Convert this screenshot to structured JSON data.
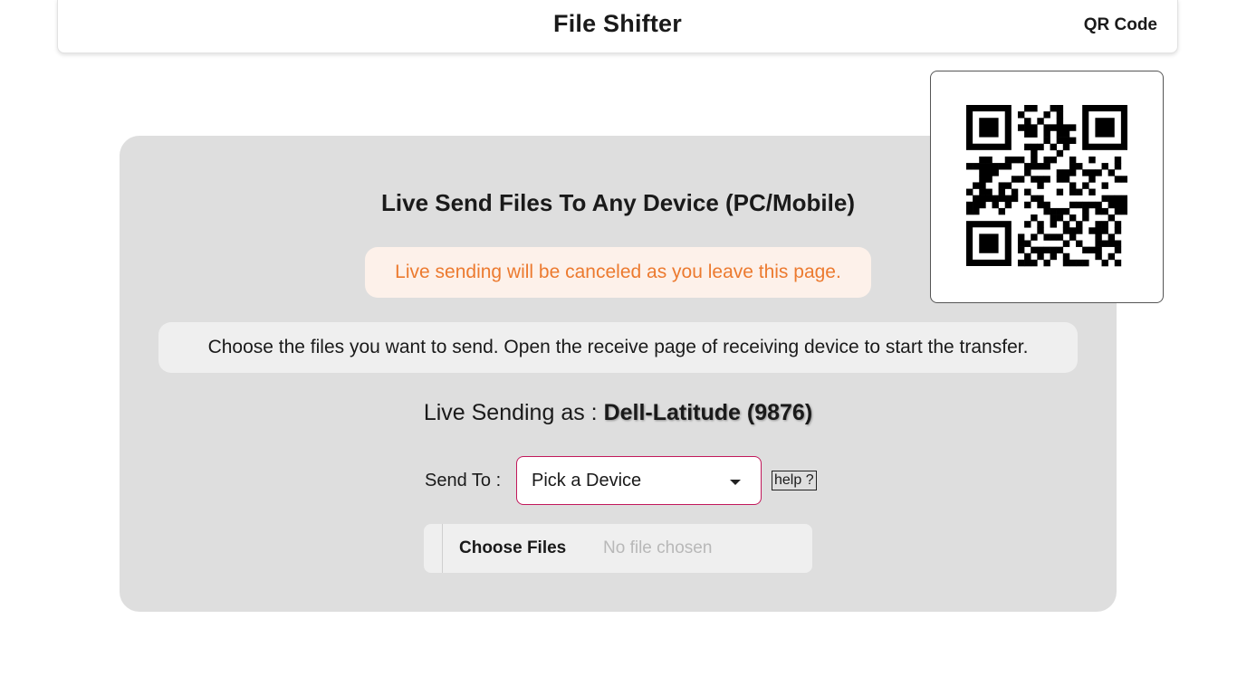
{
  "header": {
    "title": "File Shifter",
    "qr_link": "QR Code"
  },
  "qr_popup": {
    "icon": "qr-code-icon"
  },
  "main": {
    "headline": "Live Send Files To Any Device (PC/Mobile)",
    "warning": "Live sending will be canceled as you leave this page.",
    "info": "Choose the files you want to send. Open the receive page of receiving device to start the transfer.",
    "sending_as_label": "Live Sending as :",
    "device_name": "Dell-Latitude (9876)",
    "send_to_label": "Send To :",
    "device_select": {
      "selected": "Pick a Device"
    },
    "help_label": "help ?",
    "file_input": {
      "button_label": "Choose Files",
      "status": "No file chosen"
    }
  },
  "colors": {
    "warning_text": "#ec7a2f",
    "warning_bg": "#fdf1ea",
    "card_bg": "#dedede",
    "select_border": "#c2185b"
  }
}
